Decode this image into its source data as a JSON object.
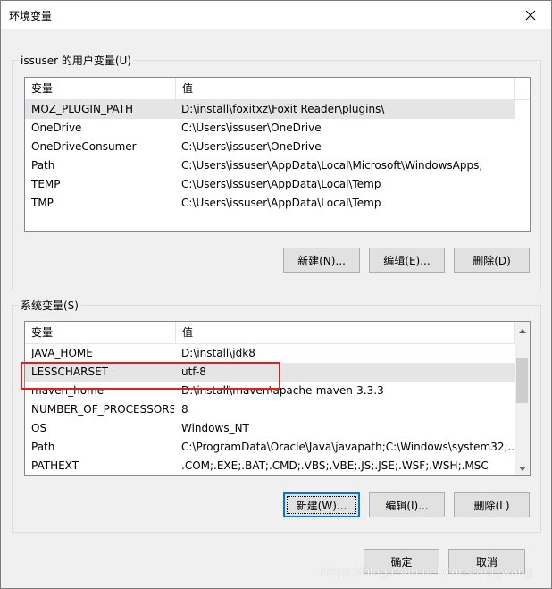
{
  "window": {
    "title": "环境变量",
    "close_glyph": "✕"
  },
  "user_vars": {
    "group_label": "issuser 的用户变量(U)",
    "col_variable": "变量",
    "col_value": "值",
    "rows": [
      {
        "name": "MOZ_PLUGIN_PATH",
        "value": "D:\\install\\foxitxz\\Foxit Reader\\plugins\\",
        "selected": true
      },
      {
        "name": "OneDrive",
        "value": "C:\\Users\\issuser\\OneDrive",
        "selected": false
      },
      {
        "name": "OneDriveConsumer",
        "value": "C:\\Users\\issuser\\OneDrive",
        "selected": false
      },
      {
        "name": "Path",
        "value": "C:\\Users\\issuser\\AppData\\Local\\Microsoft\\WindowsApps;",
        "selected": false
      },
      {
        "name": "TEMP",
        "value": "C:\\Users\\issuser\\AppData\\Local\\Temp",
        "selected": false
      },
      {
        "name": "TMP",
        "value": "C:\\Users\\issuser\\AppData\\Local\\Temp",
        "selected": false
      }
    ],
    "btn_new": "新建(N)...",
    "btn_edit": "编辑(E)...",
    "btn_delete": "删除(D)"
  },
  "sys_vars": {
    "group_label": "系统变量(S)",
    "col_variable": "变量",
    "col_value": "值",
    "rows": [
      {
        "name": "JAVA_HOME",
        "value": "D:\\install\\jdk8",
        "selected": false
      },
      {
        "name": "LESSCHARSET",
        "value": "utf-8",
        "selected": true
      },
      {
        "name": "maven_home",
        "value": "D:\\install\\maven\\apache-maven-3.3.3",
        "selected": false
      },
      {
        "name": "NUMBER_OF_PROCESSORS",
        "value": "8",
        "selected": false
      },
      {
        "name": "OS",
        "value": "Windows_NT",
        "selected": false
      },
      {
        "name": "Path",
        "value": "C:\\ProgramData\\Oracle\\Java\\javapath;C:\\Windows\\system32;...",
        "selected": false
      },
      {
        "name": "PATHEXT",
        "value": ".COM;.EXE;.BAT;.CMD;.VBS;.VBE;.JS;.JSE;.WSF;.WSH;.MSC",
        "selected": false
      }
    ],
    "btn_new": "新建(W)...",
    "btn_edit": "编辑(I)...",
    "btn_delete": "删除(L)"
  },
  "footer": {
    "btn_ok": "确定",
    "btn_cancel": "取消"
  },
  "watermark": "https://blog.csdn.net/constant_wang",
  "colors": {
    "highlight": "#e0201c",
    "default_button_border": "#0078d7",
    "selected_row": "#e5e5e5"
  }
}
